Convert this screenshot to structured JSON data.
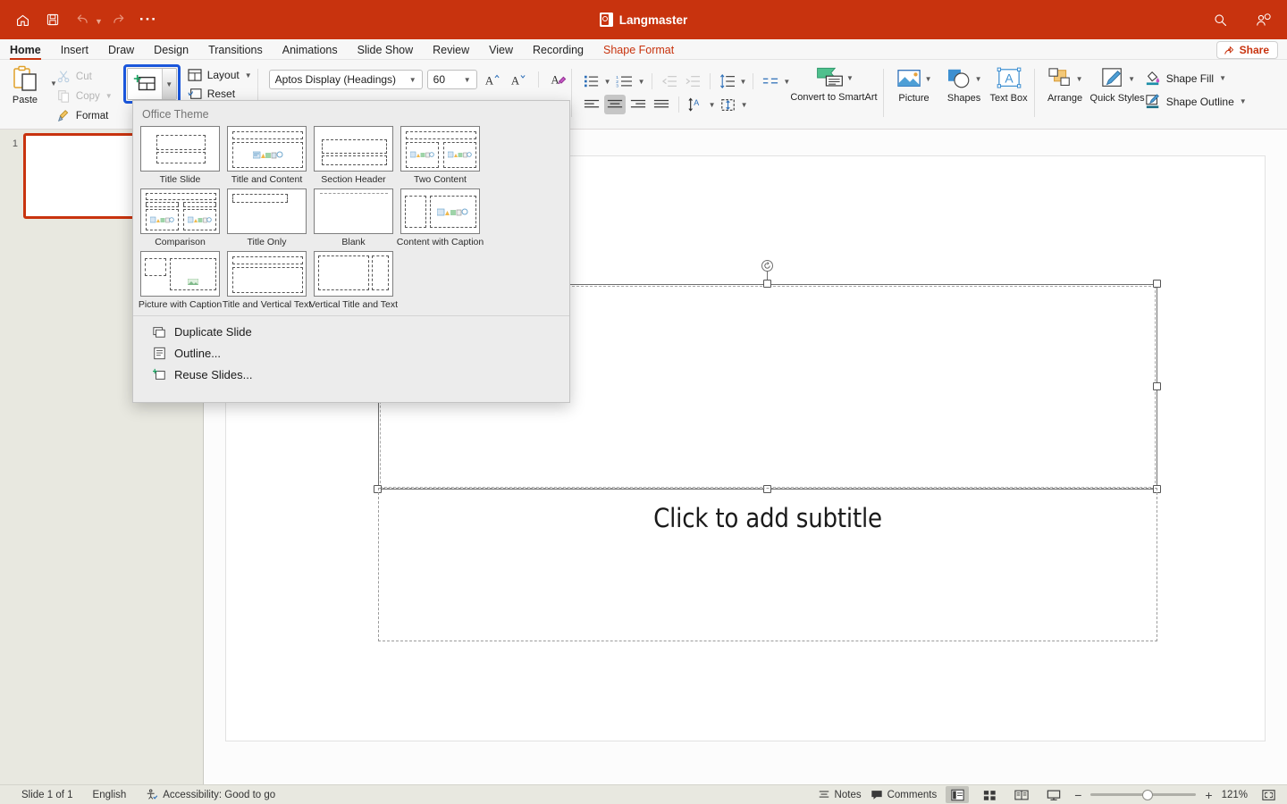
{
  "titlebar": {
    "document_title": "Langmaster",
    "icons": {
      "home": "home-icon",
      "save": "save-icon",
      "undo": "undo-icon",
      "redo": "redo-icon",
      "more": "more-options-icon",
      "search": "search-icon",
      "account": "account-icon"
    },
    "brand_color": "#C8330E"
  },
  "tabs": [
    {
      "label": "Home",
      "active": true,
      "contextual": false
    },
    {
      "label": "Insert",
      "active": false,
      "contextual": false
    },
    {
      "label": "Draw",
      "active": false,
      "contextual": false
    },
    {
      "label": "Design",
      "active": false,
      "contextual": false
    },
    {
      "label": "Transitions",
      "active": false,
      "contextual": false
    },
    {
      "label": "Animations",
      "active": false,
      "contextual": false
    },
    {
      "label": "Slide Show",
      "active": false,
      "contextual": false
    },
    {
      "label": "Review",
      "active": false,
      "contextual": false
    },
    {
      "label": "View",
      "active": false,
      "contextual": false
    },
    {
      "label": "Recording",
      "active": false,
      "contextual": false
    },
    {
      "label": "Shape Format",
      "active": false,
      "contextual": true
    }
  ],
  "share": {
    "label": "Share"
  },
  "ribbon": {
    "clipboard": {
      "paste_label": "Paste",
      "cut_label": "Cut",
      "copy_label": "Copy",
      "format_label": "Format"
    },
    "slides": {
      "new_slide_label": "New Slide",
      "layout_label": "Layout",
      "reset_label": "Reset"
    },
    "font": {
      "font_name": "Aptos Display (Headings)",
      "font_size": "60",
      "grow_font": "increase-font-size",
      "shrink_font": "decrease-font-size",
      "clear_formatting": "clear-formatting"
    },
    "paragraph": {
      "bullets": "bullets",
      "numbering": "numbering",
      "decrease_indent": "decrease-indent",
      "increase_indent": "increase-indent",
      "line_spacing": "line-spacing",
      "columns": "columns",
      "align_left": "align-left",
      "align_center": "align-center",
      "align_right": "align-right",
      "justify": "justify",
      "text_direction": "text-direction",
      "align_text": "align-text",
      "convert_smartart_label": "Convert to SmartArt"
    },
    "insert": {
      "picture_label": "Picture",
      "shapes_label": "Shapes",
      "textbox_label": "Text Box"
    },
    "drawing": {
      "arrange_label": "Arrange",
      "quick_styles_label": "Quick Styles",
      "shape_fill_label": "Shape Fill",
      "shape_outline_label": "Shape Outline"
    }
  },
  "menu": {
    "section_title": "Office Theme",
    "layouts": [
      {
        "name": "Title Slide",
        "kind": "title-slide"
      },
      {
        "name": "Title and Content",
        "kind": "title-and-content"
      },
      {
        "name": "Section Header",
        "kind": "section-header"
      },
      {
        "name": "Two Content",
        "kind": "two-content"
      },
      {
        "name": "Comparison",
        "kind": "comparison"
      },
      {
        "name": "Title Only",
        "kind": "title-only"
      },
      {
        "name": "Blank",
        "kind": "blank"
      },
      {
        "name": "Content with Caption",
        "kind": "content-with-caption"
      },
      {
        "name": "Picture with Caption",
        "kind": "picture-with-caption"
      },
      {
        "name": "Title and Vertical Text",
        "kind": "title-and-vertical-text"
      },
      {
        "name": "Vertical Title and Text",
        "kind": "vertical-title-and-text"
      }
    ],
    "commands": [
      {
        "label": "Duplicate Slide",
        "icon": "duplicate-slide-icon"
      },
      {
        "label": "Outline...",
        "icon": "outline-icon"
      },
      {
        "label": "Reuse Slides...",
        "icon": "reuse-slides-icon"
      }
    ]
  },
  "slide_panel": {
    "slides": [
      {
        "number": "1",
        "selected": true
      }
    ],
    "selection_color": "#C8330E"
  },
  "canvas": {
    "title_placeholder_text": "",
    "subtitle_placeholder_text": "Click to add subtitle"
  },
  "statusbar": {
    "slide_count_label": "Slide 1 of 1",
    "language": "English",
    "accessibility": "Accessibility: Good to go",
    "notes_label": "Notes",
    "comments_label": "Comments",
    "zoom_level": "121%",
    "views": [
      {
        "name": "normal-view",
        "active": true
      },
      {
        "name": "slide-sorter-view",
        "active": false
      },
      {
        "name": "reading-view",
        "active": false
      },
      {
        "name": "slide-show-view",
        "active": false
      }
    ],
    "zoom_out": "−",
    "zoom_in": "+",
    "fit_slide": "fit-slide-to-window"
  }
}
